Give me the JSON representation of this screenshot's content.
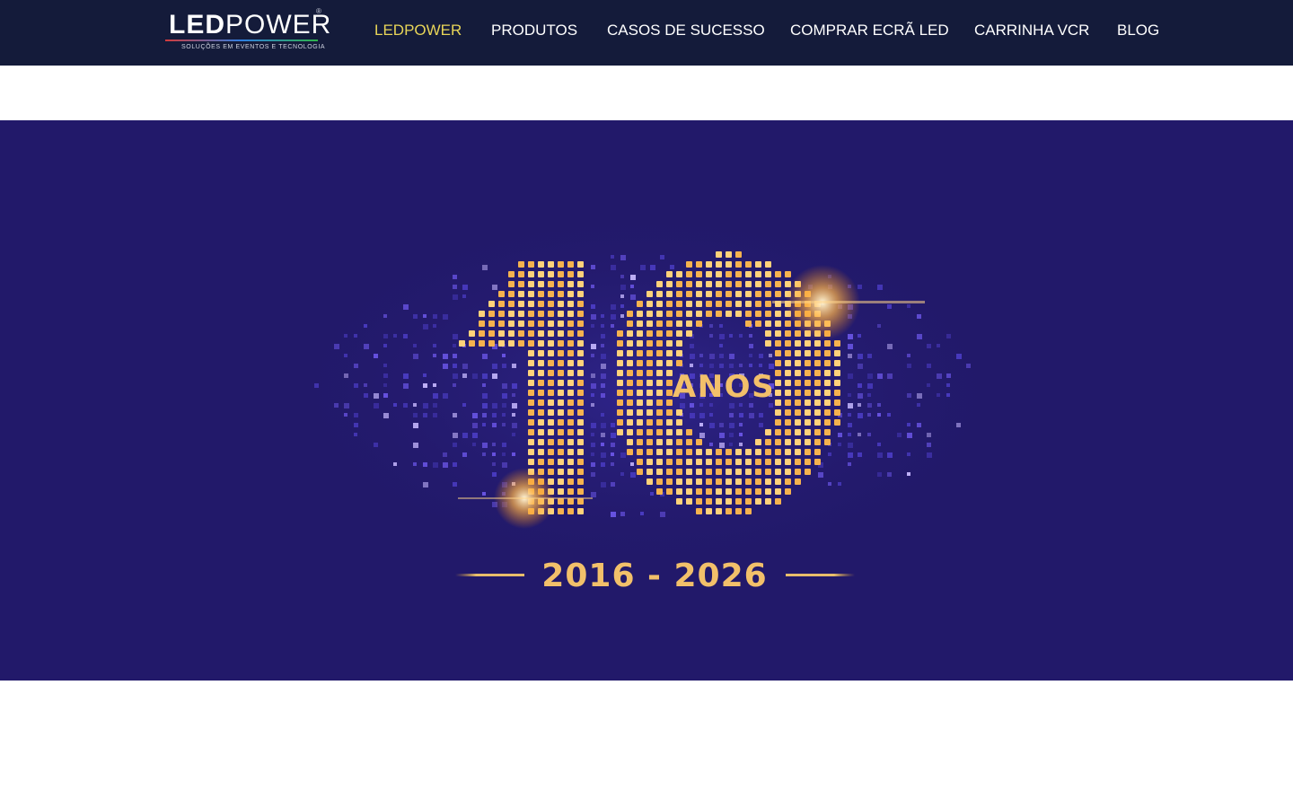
{
  "header": {
    "logo": {
      "wordmark_led": "LED",
      "wordmark_power": "POWER",
      "registered": "®",
      "tagline": "SOLUÇÕES EM EVENTOS E TECNOLOGIA"
    },
    "nav": [
      {
        "label": "LEDPOWER",
        "active": true
      },
      {
        "label": "PRODUTOS",
        "active": false
      },
      {
        "label": "CASOS DE SUCESSO",
        "active": false
      },
      {
        "label": "COMPRAR ECRÃ LED",
        "active": false
      },
      {
        "label": "CARRINHA VCR",
        "active": false
      },
      {
        "label": "BLOG",
        "active": false
      }
    ]
  },
  "hero": {
    "number": "10",
    "word": "ANOS",
    "years": "2016 - 2026"
  },
  "colors": {
    "header_bg": "#141b3a",
    "nav_active": "#e8d558",
    "hero_bg": "#22196a",
    "gold": "#f2c06a"
  }
}
